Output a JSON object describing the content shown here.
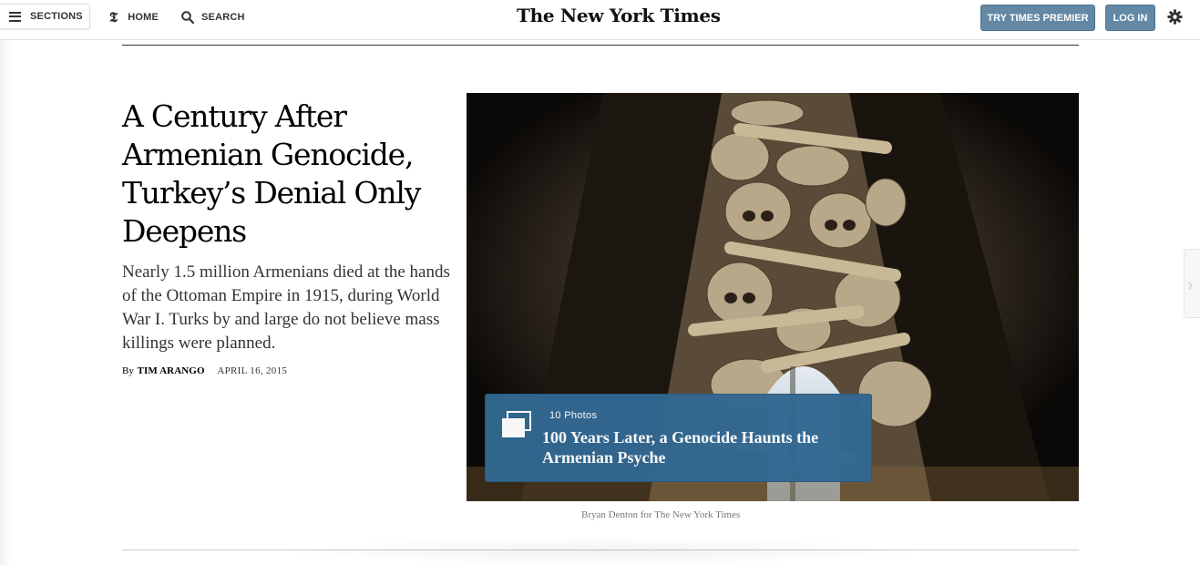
{
  "header": {
    "sections_label": "SECTIONS",
    "home_label": "HOME",
    "search_label": "SEARCH",
    "logo_text": "The New York Times",
    "premier_label": "TRY TIMES PREMIER",
    "login_label": "LOG IN"
  },
  "article": {
    "headline": "A Century After Armenian Genocide, Turkey’s Denial Only Deepens",
    "summary": "Nearly 1.5 million Armenians died at the hands of the Ottoman Empire in 1915, during World War I. Turks by and large do not believe mass killings were planned.",
    "byline_prefix": "By",
    "author": "TIM ARANGO",
    "date": "APRIL 16, 2015"
  },
  "slideshow": {
    "count": "10 Photos",
    "title": "100 Years Later, a Genocide Haunts the Armenian Psyche"
  },
  "photo_credit": "Bryan Denton for The New York Times",
  "colors": {
    "button_blue": "#6288a5",
    "slideshow_blue": "#326891"
  }
}
